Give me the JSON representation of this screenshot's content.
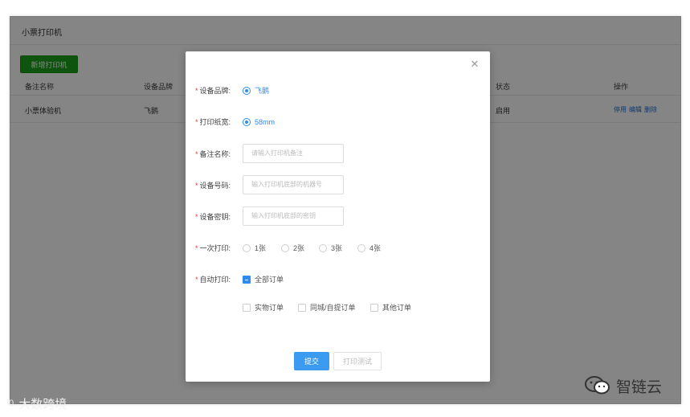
{
  "page": {
    "title": "小票打印机",
    "add_button": "新增打印机",
    "table": {
      "headers": [
        "备注名称",
        "设备品牌",
        "状态",
        "操作"
      ],
      "row": {
        "name": "小票体验机",
        "brand": "飞鹅",
        "status": "启用"
      },
      "actions": [
        "停用",
        "编辑",
        "删除"
      ]
    }
  },
  "modal": {
    "close_icon": "close-icon",
    "brand": {
      "label": "设备品牌:",
      "option": "飞鹅"
    },
    "paper": {
      "label": "打印纸宽:",
      "option": "58mm"
    },
    "remark": {
      "label": "备注名称:",
      "placeholder": "请输入打印机备注"
    },
    "device_no": {
      "label": "设备号码:",
      "placeholder": "输入打印机底部的机器号"
    },
    "device_key": {
      "label": "设备密钥:",
      "placeholder": "输入打印机底部的密钥"
    },
    "copies": {
      "label": "一次打印:",
      "options": [
        "1张",
        "2张",
        "3张",
        "4张"
      ]
    },
    "auto_print": {
      "label": "自动打印:",
      "all": "全部订单",
      "types": [
        "实物订单",
        "同城/自提订单",
        "其他订单"
      ]
    },
    "submit": "提交",
    "test": "打印测试"
  },
  "watermarks": {
    "left_logo": "\\0",
    "left_text": "大数跨境",
    "right_text": "智链云"
  },
  "colors": {
    "accent": "#2d8cf0",
    "add_button": "#1ba21b",
    "link": "#1f6fd6",
    "required": "#e4393c"
  }
}
